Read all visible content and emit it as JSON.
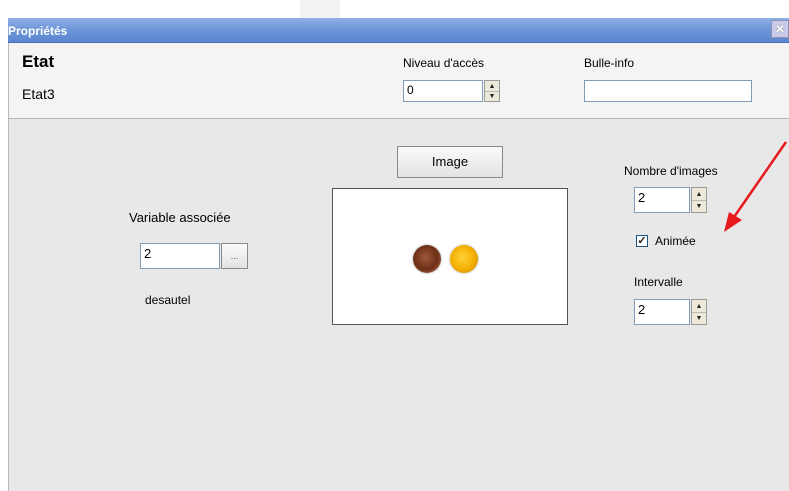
{
  "window": {
    "title": "Propriétés",
    "close_glyph": "✕"
  },
  "header": {
    "state_title": "Etat",
    "state_name": "Etat3",
    "access_level": {
      "label": "Niveau d'accès",
      "value": "0"
    },
    "tooltip": {
      "label": "Bulle-info",
      "value": ""
    }
  },
  "variable": {
    "label": "Variable associée",
    "value": "2",
    "browse_label": "...",
    "name": "desautel"
  },
  "image": {
    "button_label": "Image",
    "lamps": [
      "brown",
      "yellow"
    ]
  },
  "animation": {
    "image_count": {
      "label": "Nombre d'images",
      "value": "2"
    },
    "animated": {
      "label": "Animée",
      "checked": true,
      "check_glyph": "✓"
    },
    "interval": {
      "label": "Intervalle",
      "value": "2"
    }
  },
  "spinner": {
    "up_glyph": "▲",
    "down_glyph": "▼"
  },
  "colors": {
    "titlebar": "#6f97d9",
    "annotation_arrow": "#e8191c",
    "lamp_brown": "#6d2f18",
    "lamp_yellow": "#f3ae00"
  }
}
